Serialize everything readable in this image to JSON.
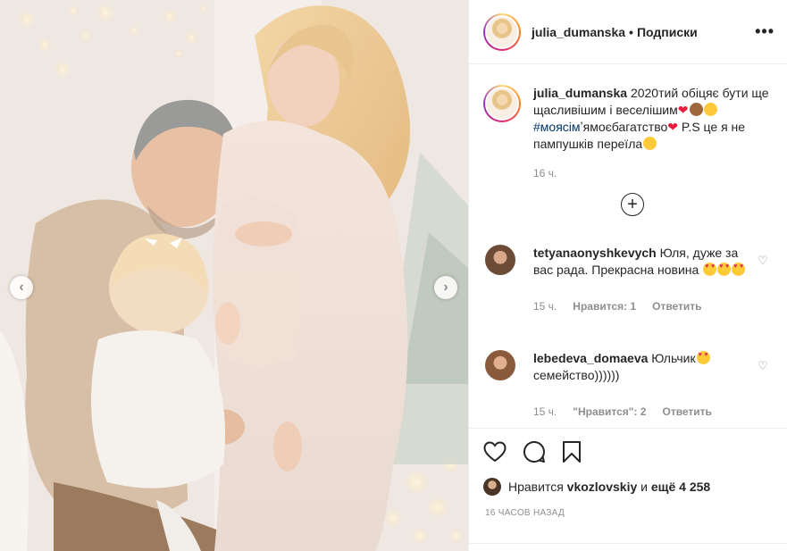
{
  "post": {
    "username": "julia_dumanska",
    "separator": "•",
    "follow_label": "Подписки",
    "more_icon": "more-options-icon"
  },
  "caption": {
    "username": "julia_dumanska",
    "text_1": "2020тий обіцяє бути ще щасливішим і веселішим",
    "hashtag": "#моясім",
    "text_2": "ʼямоєбагатство",
    "text_3": "P.S це я не пампушків переїла",
    "time": "16 ч."
  },
  "comments": [
    {
      "username": "tetyanaonyshkevych",
      "text": "Юля, дуже за вас рада. Прекрасна новина",
      "time": "15 ч.",
      "likes": "Нравится: 1",
      "reply": "Ответить",
      "avatar_color": "#6b4a36"
    },
    {
      "username": "lebedeva_domaeva",
      "text": "Юльчик",
      "text_2": "семейство))))))",
      "time": "15 ч.",
      "likes": "\"Нравится\": 2",
      "reply": "Ответить",
      "avatar_color": "#8a5a3c"
    }
  ],
  "likes": {
    "prefix": "Нравится",
    "user": "vkozlovskiy",
    "middle": "и",
    "rest": "ещё 4 258"
  },
  "post_date": "16 ЧАСОВ НАЗАД",
  "colors": {
    "hashtag": "#00376b",
    "heart": "#ed1c3c",
    "meta": "#8e8e8e"
  }
}
